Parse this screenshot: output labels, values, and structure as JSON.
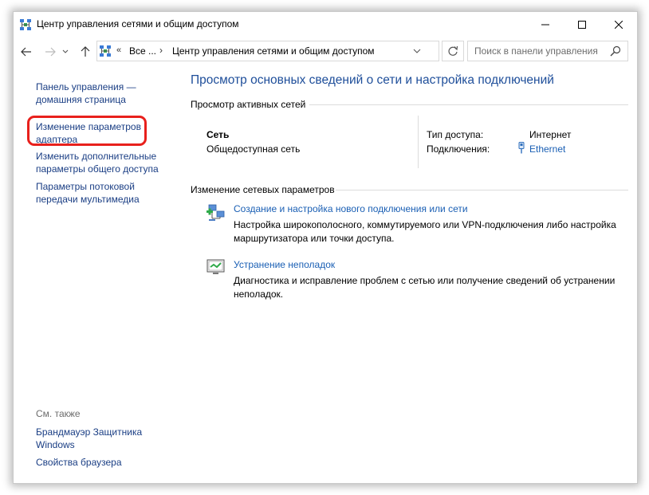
{
  "window": {
    "title": "Центр управления сетями и общим доступом"
  },
  "address": {
    "chevron": "«",
    "root": "Все ...",
    "separator": "›",
    "path": "Центр управления сетями и общим доступом",
    "search_placeholder": "Поиск в панели управления"
  },
  "sidebar": {
    "home_link": "Панель управления — домашняя страница",
    "items": [
      {
        "label": "Изменение параметров адаптера"
      },
      {
        "label": "Изменить дополнительные параметры общего доступа"
      },
      {
        "label": "Параметры потоковой передачи мультимедиа"
      }
    ],
    "see_also_label": "См. также",
    "see_also": [
      {
        "label": "Брандмауэр Защитника Windows"
      },
      {
        "label": "Свойства браузера"
      }
    ]
  },
  "main": {
    "title": "Просмотр основных сведений о сети и настройка подключений",
    "active_networks_header": "Просмотр активных сетей",
    "network": {
      "name": "Сеть",
      "type": "Общедоступная сеть",
      "access_type_label": "Тип доступа:",
      "access_type_value": "Интернет",
      "connections_label": "Подключения:",
      "connections_value": "Ethernet"
    },
    "change_settings_header": "Изменение сетевых параметров",
    "tasks": [
      {
        "link": "Создание и настройка нового подключения или сети",
        "description": "Настройка широкополосного, коммутируемого или VPN-подключения либо настройка маршрутизатора или точки доступа."
      },
      {
        "link": "Устранение неполадок",
        "description": "Диагностика и исправление проблем с сетью или получение сведений об устранении неполадок."
      }
    ]
  },
  "colors": {
    "link": "#1a5fb4",
    "sidebar_link": "#1a3e84",
    "title": "#1e4e9a",
    "highlight": "#e8201c"
  },
  "icons": {
    "app": "network-center-icon",
    "back": "arrow-left-icon",
    "forward": "arrow-right-icon",
    "up": "arrow-up-icon",
    "refresh": "refresh-icon",
    "search": "search-icon",
    "ethernet": "ethernet-icon",
    "new_connection": "new-connection-icon",
    "troubleshoot": "troubleshoot-icon"
  }
}
